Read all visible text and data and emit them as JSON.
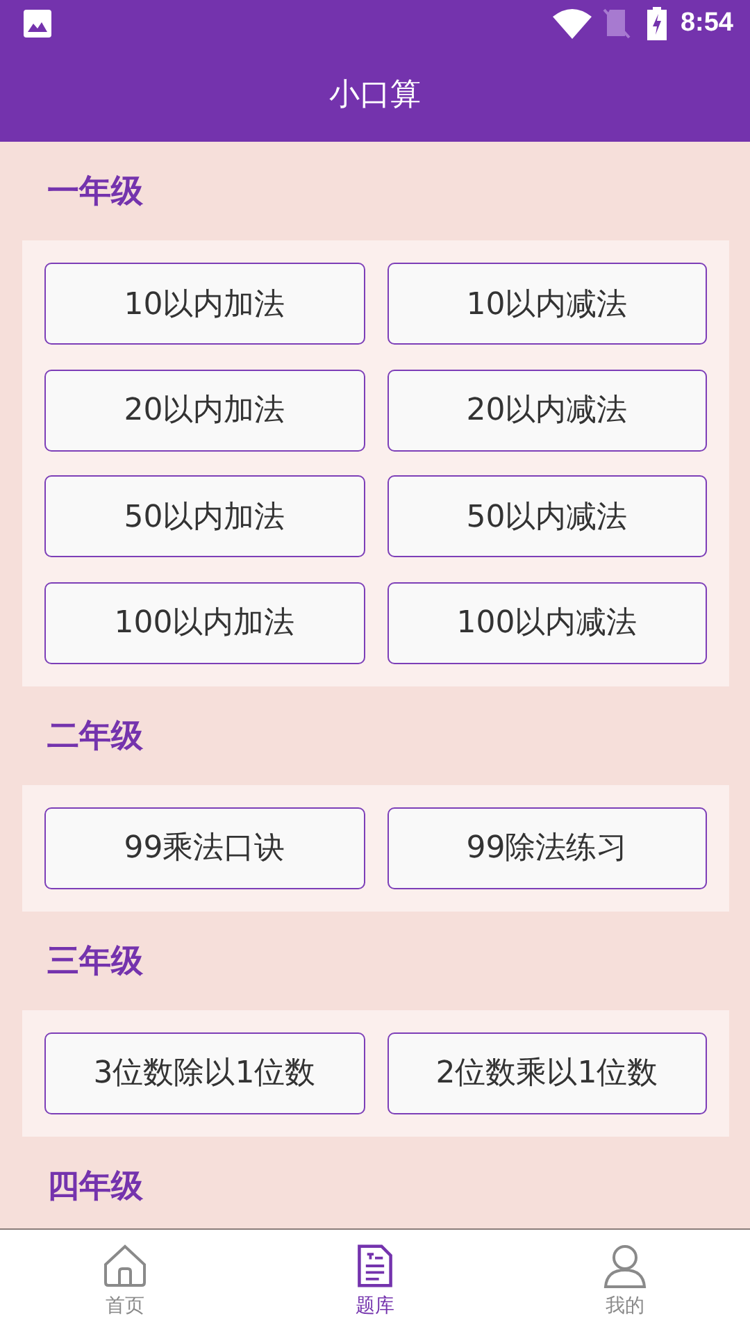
{
  "status_bar": {
    "time": "8:54"
  },
  "app_bar": {
    "title": "小口算"
  },
  "sections": [
    {
      "title": "一年级",
      "buttons": [
        "10以内加法",
        "10以内减法",
        "20以内加法",
        "20以内减法",
        "50以内加法",
        "50以内减法",
        "100以内加法",
        "100以内减法"
      ]
    },
    {
      "title": "二年级",
      "buttons": [
        "99乘法口诀",
        "99除法练习"
      ]
    },
    {
      "title": "三年级",
      "buttons": [
        "3位数除以1位数",
        "2位数乘以1位数"
      ]
    },
    {
      "title": "四年级"
    }
  ],
  "bottom_nav": [
    {
      "kind": "home",
      "label": "首页",
      "selected": false
    },
    {
      "kind": "document",
      "label": "题库",
      "selected": true
    },
    {
      "kind": "person",
      "label": "我的",
      "selected": false
    }
  ]
}
